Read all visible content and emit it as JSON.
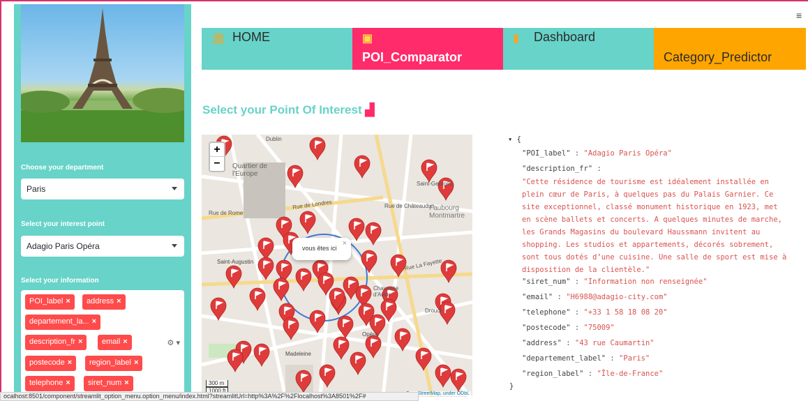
{
  "sidebar": {
    "department_label": "Choose your department",
    "department_value": "Paris",
    "poi_label": "Select your interest point",
    "poi_value": "Adagio Paris Opéra",
    "info_label": "Select your information",
    "tags": [
      "POI_label",
      "address",
      "departement_la...",
      "description_fr",
      "email",
      "postecode",
      "region_label",
      "telephone",
      "siret_num"
    ],
    "tag_remove_glyph": "×"
  },
  "nav": {
    "items": [
      {
        "label": "HOME",
        "icon": "bank-icon",
        "bg": "#67d3c9",
        "active": false
      },
      {
        "label": "POI_Comparator",
        "icon": "binoculars-icon",
        "bg": "#ff2b6b",
        "active": true
      },
      {
        "label": "Dashboard",
        "icon": "bar-chart-icon",
        "bg": "#67d3c9",
        "active": false
      },
      {
        "label": "Category_Predictor",
        "icon": "",
        "bg": "#ffa500",
        "active": false
      }
    ]
  },
  "main": {
    "title": "Select your Point Of Interest",
    "map": {
      "zoom_in": "+",
      "zoom_out": "−",
      "popup_text": "vous êtes ici",
      "popup_close": "×",
      "scale_label_m": "300 m",
      "scale_label_ft": "1000 ft",
      "attribution": "OpenStreetMap, under ODbL",
      "place_labels": [
        "Dublin",
        "Quartier de l'Europe",
        "Rue de Londres",
        "Rue de Châteaudun",
        "Faubourg Montmartre",
        "Saint-Augustin",
        "Madeleine",
        "Opéra",
        "Saint-Georges",
        "Rue de Rome",
        "Rue La Fayette",
        "Drouot",
        "Chaussée d'Antin"
      ]
    },
    "json": {
      "open_brace": "{",
      "close_brace": "}",
      "fields": [
        {
          "key": "\"POI_label\"",
          "value": "\"Adagio Paris Opéra\""
        },
        {
          "key": "\"siret_num\"",
          "value": "\"Information non renseignée\""
        },
        {
          "key": "\"email\"",
          "value": "\"H6988@adagio-city.com\""
        },
        {
          "key": "\"telephone\"",
          "value": "\"+33 1 58 18 08 20\""
        },
        {
          "key": "\"postecode\"",
          "value": "\"75009\""
        },
        {
          "key": "\"address\"",
          "value": "\"43 rue Caumartin\""
        },
        {
          "key": "\"departement_label\"",
          "value": "\"Paris\""
        },
        {
          "key": "\"region_label\"",
          "value": "\"Île-de-France\""
        }
      ],
      "description_key": "\"description_fr\"",
      "description_lines": [
        "\"Cette résidence de tourisme est idéalement installée en",
        "plein cœur de Paris, à quelques pas du Palais Garnier. Ce",
        "site exceptionnel, classé monument historique en 1923, met",
        "en scène ballets et concerts. A quelques minutes de marche,",
        "les Grands Magasins du boulevard Haussmann invitent au",
        "shopping. Les studios et appartements, décorés sobrement,",
        "sont tous dotés d’une cuisine. Une salle de sport est mise à",
        "disposition de la clientèle.\""
      ]
    }
  },
  "statusbar": "ocalhost:8501/component/streamlit_option_menu.option_menu/index.html?streamlitUrl=http%3A%2F%2Flocalhost%3A8501%2F#",
  "colors": {
    "accent": "#67d3c9",
    "active": "#ff2b6b",
    "orange": "#ffa500",
    "tag": "#ff4b4b",
    "marker": "#e03b3b"
  }
}
